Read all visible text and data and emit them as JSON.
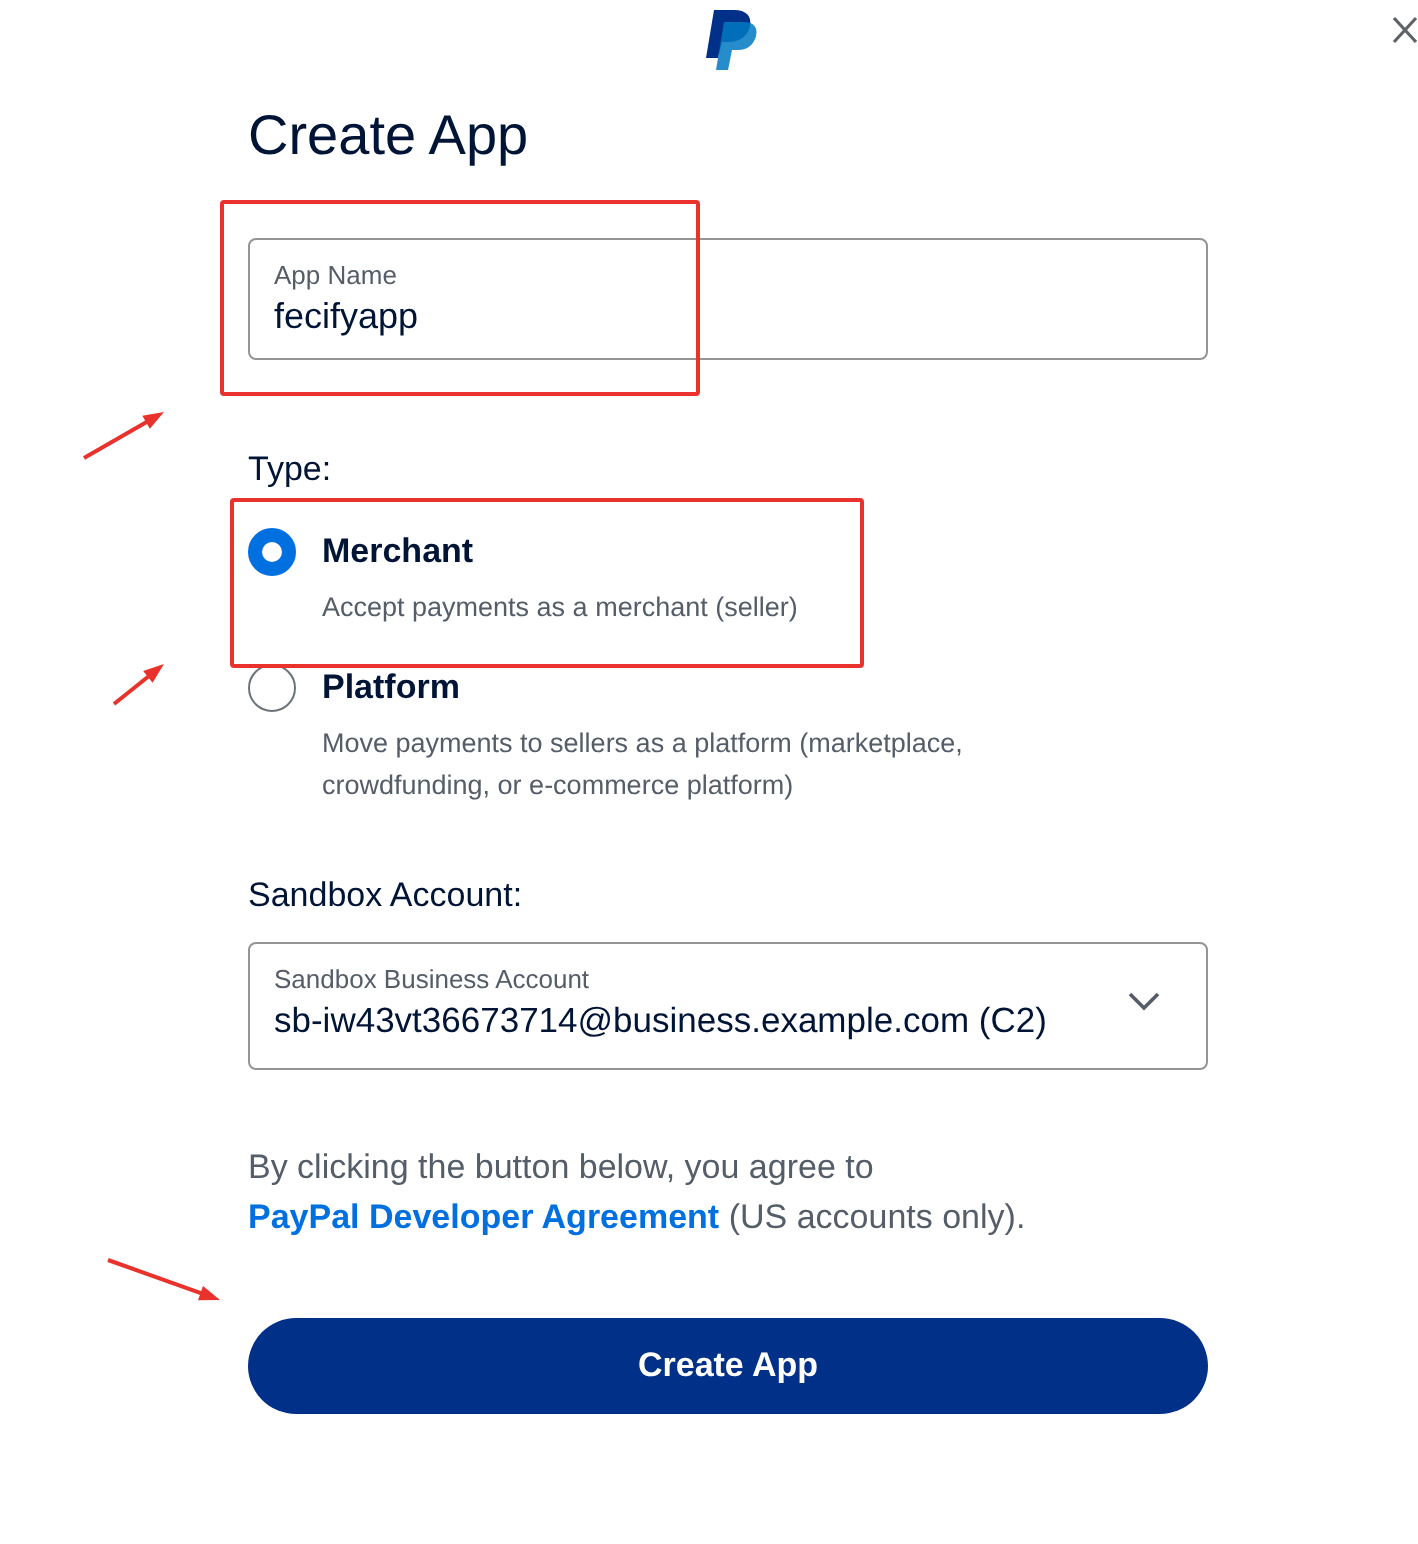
{
  "title": "Create App",
  "app_name": {
    "label": "App Name",
    "value": "fecifyapp"
  },
  "type": {
    "label": "Type:",
    "options": [
      {
        "title": "Merchant",
        "description": "Accept payments as a merchant (seller)",
        "selected": true
      },
      {
        "title": "Platform",
        "description": "Move payments to sellers as a platform (marketplace, crowdfunding, or e-commerce platform)",
        "selected": false
      }
    ]
  },
  "sandbox": {
    "label": "Sandbox Account:",
    "select_label": "Sandbox Business Account",
    "value": "sb-iw43vt36673714@business.example.com (C2)"
  },
  "agreement": {
    "before": "By clicking the button below, you agree to",
    "link": "PayPal Developer Agreement",
    "after": "(US accounts only)."
  },
  "button": "Create App"
}
